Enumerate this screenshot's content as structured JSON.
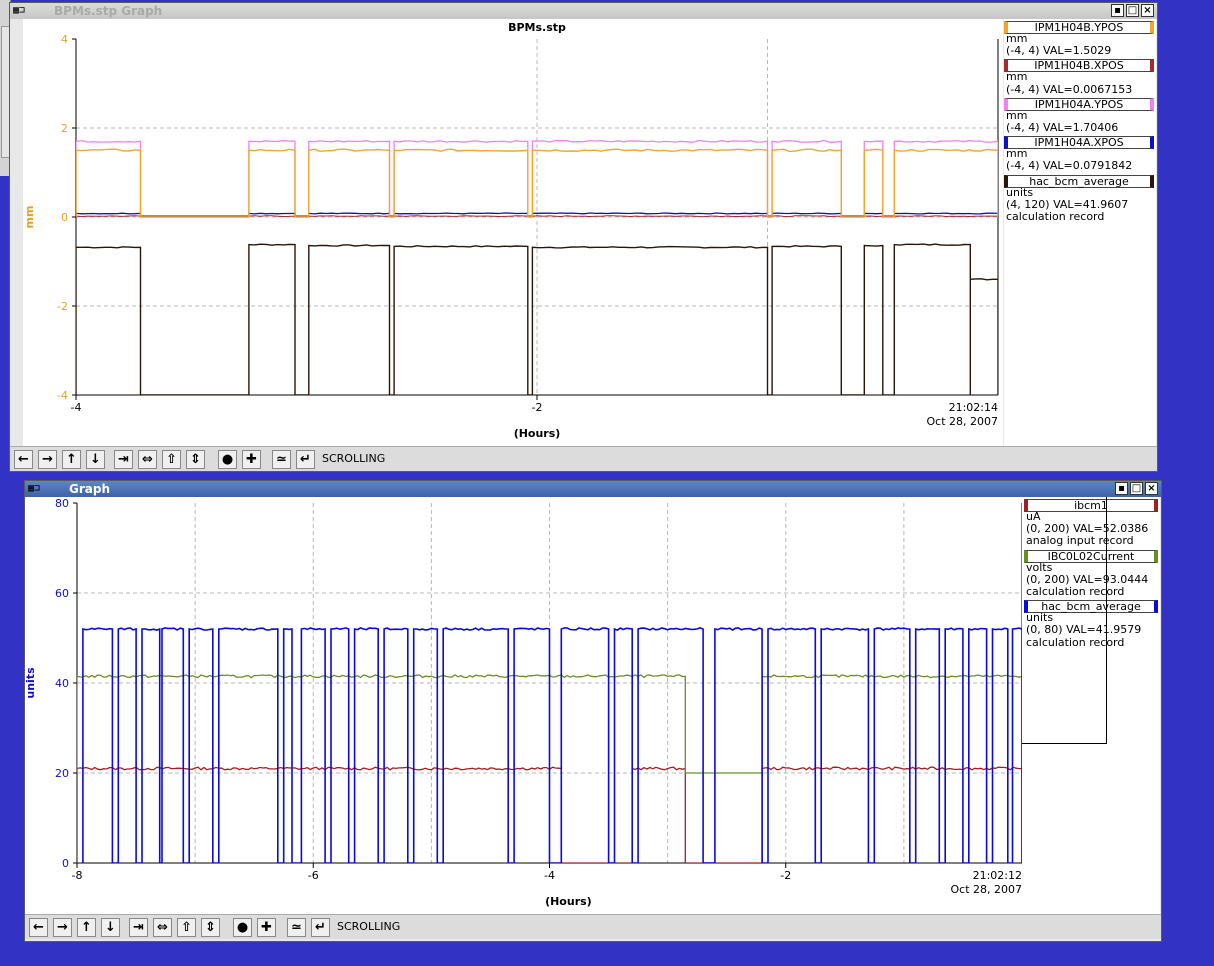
{
  "windows": [
    {
      "title": "BPMs.stp Graph",
      "chart_data": {
        "type": "line",
        "title": "BPMs.stp",
        "xlabel": "(Hours)",
        "ylabel": "mm",
        "xlim": [
          -4,
          0
        ],
        "ylim": [
          -4,
          4
        ],
        "x_ticks": [
          "-4",
          "-2"
        ],
        "y_ticks": [
          "4",
          "2",
          "0",
          "-2",
          "-4"
        ],
        "end_time": "21:02:14",
        "end_date": "Oct 28, 2007",
        "grid": true,
        "series": [
          {
            "name": "IPM1H04B.YPOS",
            "color": "#f3a72a",
            "units": "mm",
            "range_text": "(-4, 4) VAL=1.5029",
            "extra": "",
            "x": [
              -4.0,
              -3.72,
              -3.71,
              -3.24,
              -3.23,
              -3.0,
              -2.99,
              -1.32,
              -1.31,
              -2.64,
              -2.63,
              -2.04,
              -2.03,
              -1.0,
              -0.99
            ],
            "y": [
              1.5,
              1.5,
              0.0,
              0.0,
              1.5,
              1.5,
              0.0,
              0.0,
              1.5,
              1.5,
              0.0,
              0.0,
              1.5,
              1.5,
              1.5
            ]
          },
          {
            "name": "IPM1H04B.XPOS",
            "color": "#a52a2a",
            "units": "mm",
            "range_text": "(-4, 4) VAL=0.0067153",
            "extra": ""
          },
          {
            "name": "IPM1H04A.YPOS",
            "color": "#ee82ee",
            "units": "mm",
            "range_text": "(-4, 4) VAL=1.70406",
            "extra": ""
          },
          {
            "name": "IPM1H04A.XPOS",
            "color": "#1010c0",
            "units": "mm",
            "range_text": "(-4, 4) VAL=0.0791842",
            "extra": ""
          },
          {
            "name": "hac_bcm_average",
            "color": "#2a1608",
            "units": "units",
            "range_text": "(4, 120) VAL=41.9607",
            "extra": "calculation record"
          }
        ]
      },
      "toolbar_label": "SCROLLING"
    },
    {
      "title": "Graph",
      "chart_data": {
        "type": "line",
        "title": "",
        "xlabel": "(Hours)",
        "ylabel": "units",
        "xlim": [
          -8,
          0
        ],
        "ylim": [
          0,
          80
        ],
        "x_ticks": [
          "-8",
          "-6",
          "-4",
          "-2"
        ],
        "y_ticks": [
          "80",
          "60",
          "40",
          "20",
          "0"
        ],
        "end_time": "21:02:12",
        "end_date": "Oct 28, 2007",
        "grid": true,
        "series": [
          {
            "name": "ibcm1",
            "color": "#a02020",
            "units": "uA",
            "range_text": "(0, 200) VAL=52.0386",
            "extra": "analog input record"
          },
          {
            "name": "IBC0L02Current",
            "color": "#6b8e23",
            "units": "volts",
            "range_text": "(0, 200) VAL=93.0444",
            "extra": "calculation record"
          },
          {
            "name": "hac_bcm_average",
            "color": "#0a0ae0",
            "units": "units",
            "range_text": "(0, 80) VAL=41.9579",
            "extra": "calculation record"
          }
        ]
      },
      "toolbar_label": "SCROLLING"
    }
  ],
  "toolbar_icons": [
    "arrow-left-icon",
    "arrow-right-icon",
    "arrow-up-icon",
    "arrow-down-icon",
    "compress-horizontal-icon",
    "expand-horizontal-icon",
    "compress-vertical-icon",
    "expand-vertical-icon",
    "record-icon",
    "plus-icon",
    "trend-icon",
    "return-icon"
  ],
  "toolbar_glyphs": [
    "←",
    "→",
    "↑",
    "↓",
    "⇥",
    "⇔",
    "⇧",
    "⇕",
    "●",
    "✚",
    "≃",
    "↵"
  ]
}
